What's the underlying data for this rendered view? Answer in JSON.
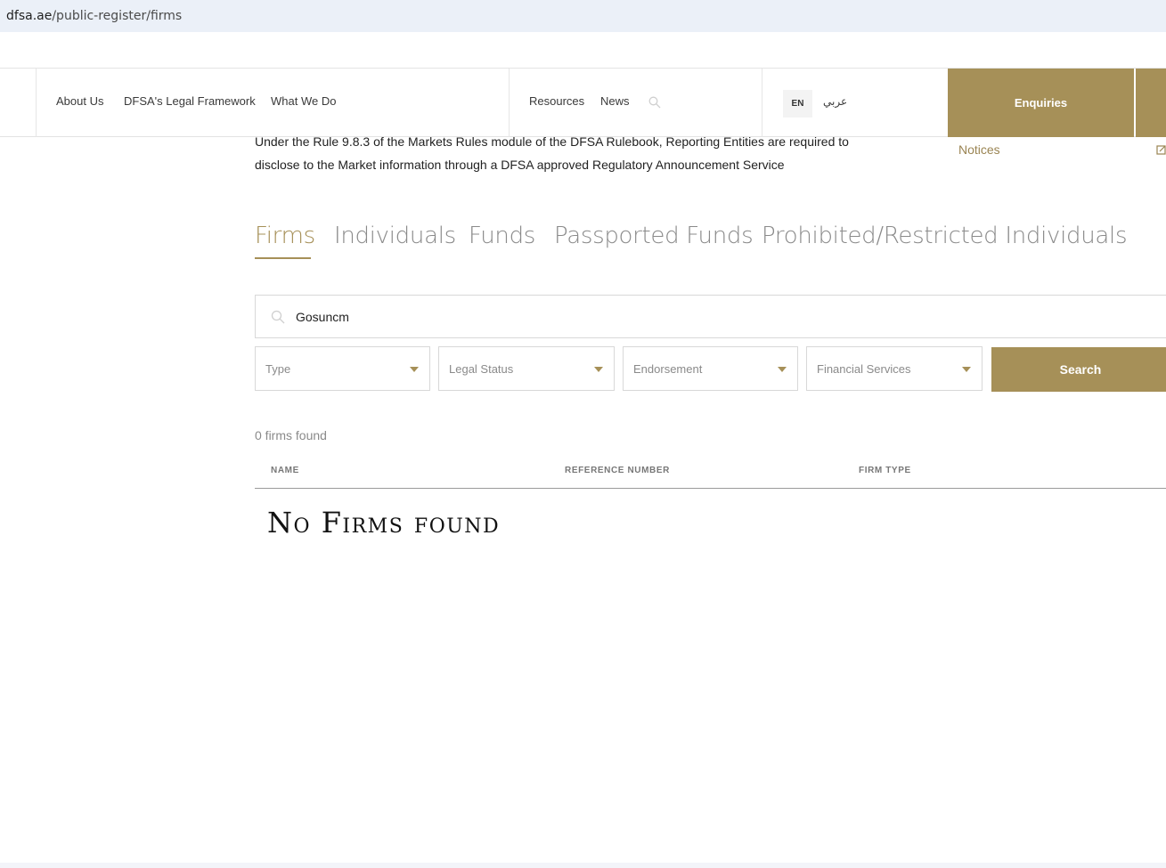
{
  "browser": {
    "url_host": "dfsa.ae",
    "url_path": "/public-register/firms"
  },
  "nav": {
    "items": [
      "About Us",
      "DFSA's Legal Framework",
      "What We Do",
      "Resources",
      "News"
    ],
    "lang_en": "EN",
    "lang_ar": "عربي",
    "enquiries": "Enquiries"
  },
  "intro": {
    "text": "Under the Rule 9.8.3 of the Markets Rules module of the DFSA Rulebook, Reporting Entities are required to disclose to the Market information through a DFSA approved Regulatory Announcement Service"
  },
  "side": {
    "notices": "Notices"
  },
  "tabs": [
    "Firms",
    "Individuals",
    "Funds",
    "Passported Funds",
    "Prohibited/Restricted Individuals"
  ],
  "search": {
    "value": "Gosuncm"
  },
  "filters": [
    "Type",
    "Legal Status",
    "Endorsement",
    "Financial Services"
  ],
  "search_button": "Search",
  "results": {
    "count_text": "0 firms found",
    "columns": [
      "NAME",
      "REFERENCE NUMBER",
      "FIRM TYPE"
    ],
    "empty_message": "No Firms found"
  },
  "colors": {
    "accent": "#a69058",
    "text": "#2b2b2b",
    "muted": "#8a8a8a"
  }
}
